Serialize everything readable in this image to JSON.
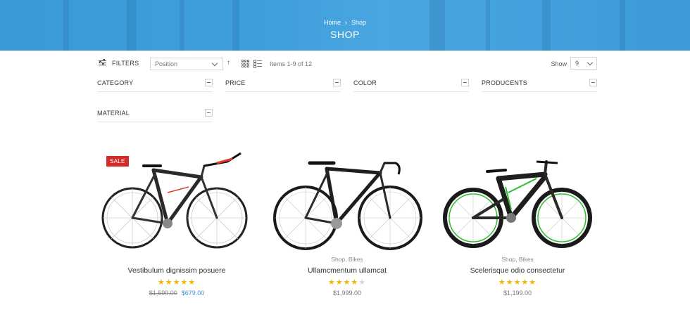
{
  "banner": {
    "breadcrumb": [
      {
        "label": "Home"
      },
      {
        "label": "Shop"
      }
    ],
    "separator": "›",
    "title": "SHOP",
    "color": "#3d9dda"
  },
  "toolbar": {
    "filters_label": "FILTERS",
    "sort": {
      "selected": "Position"
    },
    "sort_direction_glyph": "↑",
    "items_count": "Items 1-9 of 12",
    "show_label": "Show",
    "show_select": {
      "selected": "9"
    }
  },
  "filters": [
    {
      "label": "CATEGORY"
    },
    {
      "label": "PRICE"
    },
    {
      "label": "COLOR"
    },
    {
      "label": "PRODUCENTS"
    },
    {
      "label": "MATERIAL"
    }
  ],
  "products": [
    {
      "badge": "SALE",
      "category": "",
      "name": "Vestibulum dignissim posuere",
      "rating": 5,
      "stars": "★★★★★",
      "old_price": "$1,599.00",
      "price": "$679.00",
      "bike_color": "#2a2a2a",
      "accent_color": "#e23a2a"
    },
    {
      "badge": "",
      "category": "Shop, Bikes",
      "name": "Ullamcmentum ullamcat",
      "rating": 4,
      "stars_on": "★★★★",
      "stars_off": "★",
      "price": "$1,999.00",
      "bike_color": "#1e1e1e",
      "accent_color": "#ffffff"
    },
    {
      "badge": "",
      "category": "Shop, Bikes",
      "name": "Scelerisque odio consectetur",
      "rating": 5,
      "stars": "★★★★★",
      "price": "$1,199.00",
      "bike_color": "#1e1e1e",
      "accent_color": "#2bbd2b"
    }
  ],
  "colors": {
    "sale": "#d32a2a",
    "price_accent": "#3a96d4",
    "star": "#f2b600"
  }
}
